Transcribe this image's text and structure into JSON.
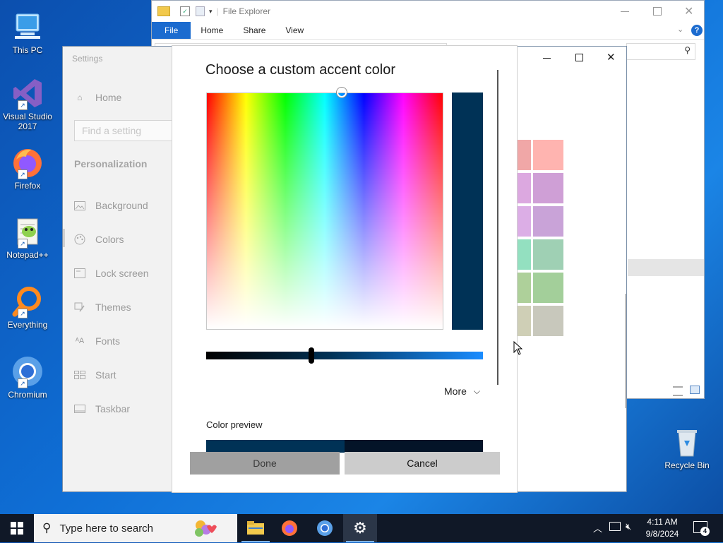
{
  "desktop": {
    "icons": [
      {
        "label": "This PC"
      },
      {
        "label": "Visual Studio 2017"
      },
      {
        "label": "Firefox"
      },
      {
        "label": "Notepad++"
      },
      {
        "label": "Everything"
      },
      {
        "label": "Chromium"
      }
    ],
    "recycle_bin": "Recycle Bin"
  },
  "file_explorer": {
    "title": "File Explorer",
    "tabs": [
      "File",
      "Home",
      "Share",
      "View"
    ]
  },
  "settings": {
    "title": "Settings",
    "home": "Home",
    "search_placeholder": "Find a setting",
    "section": "Personalization",
    "nav": [
      "Background",
      "Colors",
      "Lock screen",
      "Themes",
      "Fonts",
      "Start",
      "Taskbar"
    ]
  },
  "dialog": {
    "title": "Choose a custom accent color",
    "more": "More",
    "color_preview": "Color preview",
    "done": "Done",
    "cancel": "Cancel",
    "selected_color": "#003256",
    "brightness_fraction": 0.38
  },
  "taskbar": {
    "search_placeholder": "Type here to search",
    "time": "4:11 AM",
    "date": "9/8/2024",
    "notification_count": "4"
  }
}
